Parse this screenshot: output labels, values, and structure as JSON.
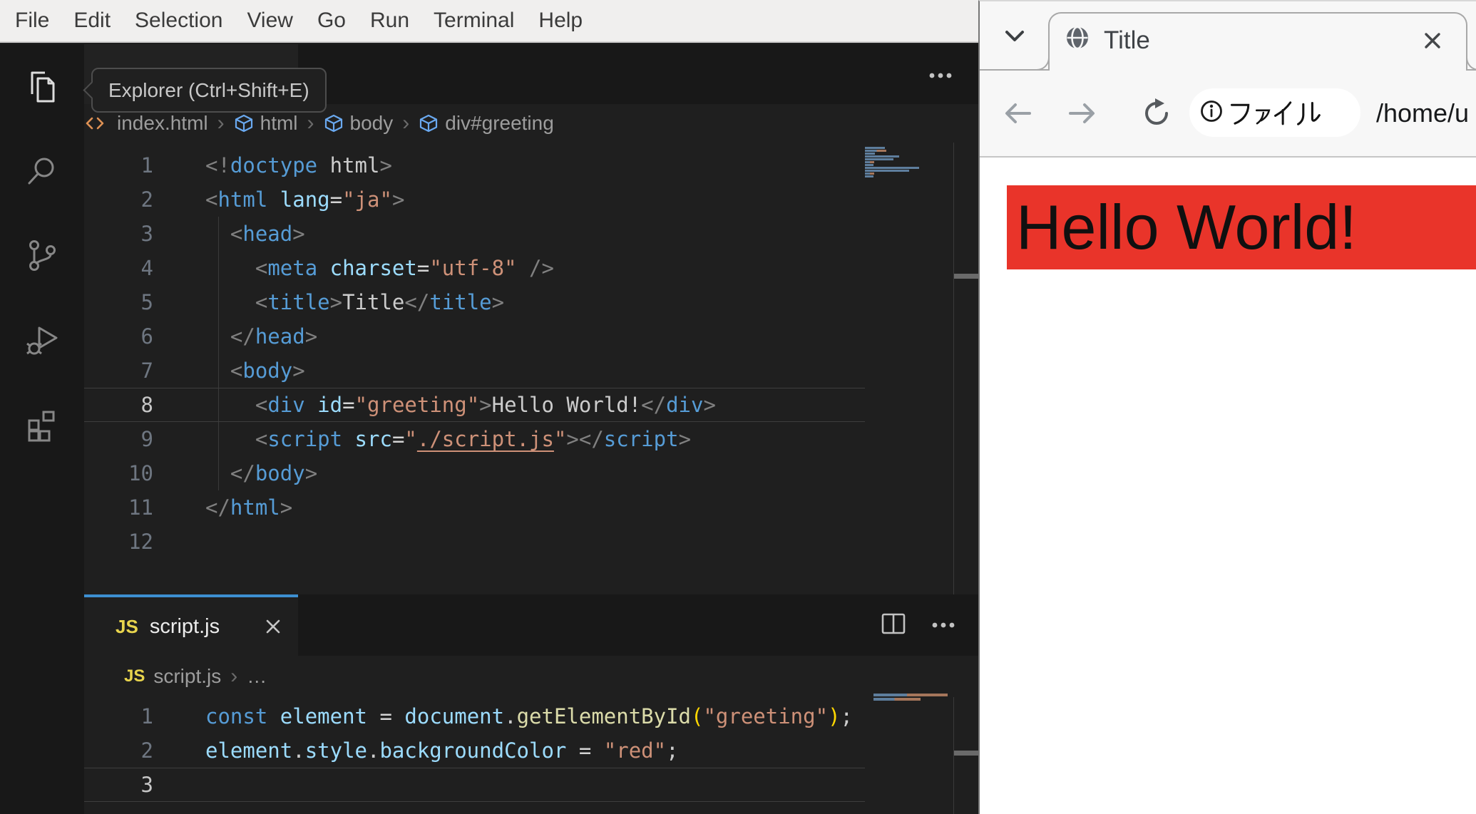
{
  "vscode": {
    "menu": {
      "items": [
        "File",
        "Edit",
        "Selection",
        "View",
        "Go",
        "Run",
        "Terminal",
        "Help"
      ]
    },
    "activity_bar": [
      "explorer",
      "search",
      "source-control",
      "run-debug",
      "extensions"
    ],
    "tooltip": "Explorer (Ctrl+Shift+E)",
    "top_editor": {
      "breadcrumbs": [
        {
          "icon": "code",
          "label": "index.html"
        },
        {
          "icon": "cube",
          "label": "html"
        },
        {
          "icon": "cube",
          "label": "body"
        },
        {
          "icon": "cube",
          "label": "div#greeting"
        }
      ],
      "active_line": 8,
      "lines": [
        {
          "n": "1",
          "t": [
            [
              "p",
              "<!"
            ],
            [
              "tag",
              "doctype"
            ],
            [
              "pl",
              " html"
            ],
            [
              "p",
              ">"
            ]
          ]
        },
        {
          "n": "2",
          "t": [
            [
              "p",
              "<"
            ],
            [
              "tag",
              "html"
            ],
            [
              "pl",
              " "
            ],
            [
              "at",
              "lang"
            ],
            [
              "op",
              "="
            ],
            [
              "st",
              "\"ja\""
            ],
            [
              "p",
              ">"
            ]
          ]
        },
        {
          "n": "3",
          "t": [
            [
              "pl",
              "  "
            ],
            [
              "p",
              "<"
            ],
            [
              "tag",
              "head"
            ],
            [
              "p",
              ">"
            ]
          ]
        },
        {
          "n": "4",
          "t": [
            [
              "pl",
              "    "
            ],
            [
              "p",
              "<"
            ],
            [
              "tag",
              "meta"
            ],
            [
              "pl",
              " "
            ],
            [
              "at",
              "charset"
            ],
            [
              "op",
              "="
            ],
            [
              "st",
              "\"utf-8\""
            ],
            [
              "pl",
              " "
            ],
            [
              "p",
              "/>"
            ]
          ]
        },
        {
          "n": "5",
          "t": [
            [
              "pl",
              "    "
            ],
            [
              "p",
              "<"
            ],
            [
              "tag",
              "title"
            ],
            [
              "p",
              ">"
            ],
            [
              "pl",
              "Title"
            ],
            [
              "p",
              "</"
            ],
            [
              "tag",
              "title"
            ],
            [
              "p",
              ">"
            ]
          ]
        },
        {
          "n": "6",
          "t": [
            [
              "pl",
              "  "
            ],
            [
              "p",
              "</"
            ],
            [
              "tag",
              "head"
            ],
            [
              "p",
              ">"
            ]
          ]
        },
        {
          "n": "7",
          "t": [
            [
              "pl",
              "  "
            ],
            [
              "p",
              "<"
            ],
            [
              "tag",
              "body"
            ],
            [
              "p",
              ">"
            ]
          ]
        },
        {
          "n": "8",
          "t": [
            [
              "pl",
              "    "
            ],
            [
              "p",
              "<"
            ],
            [
              "tag",
              "div"
            ],
            [
              "pl",
              " "
            ],
            [
              "at",
              "id"
            ],
            [
              "op",
              "="
            ],
            [
              "st",
              "\"greeting\""
            ],
            [
              "p",
              ">"
            ],
            [
              "pl",
              "Hello World!"
            ],
            [
              "p",
              "</"
            ],
            [
              "tag",
              "div"
            ],
            [
              "p",
              ">"
            ]
          ]
        },
        {
          "n": "9",
          "t": [
            [
              "pl",
              "    "
            ],
            [
              "p",
              "<"
            ],
            [
              "tag",
              "script"
            ],
            [
              "pl",
              " "
            ],
            [
              "at",
              "src"
            ],
            [
              "op",
              "="
            ],
            [
              "st",
              "\""
            ],
            [
              "lk",
              "./script.js"
            ],
            [
              "st",
              "\""
            ],
            [
              "p",
              ">"
            ],
            [
              "p",
              "</"
            ],
            [
              "tag",
              "script"
            ],
            [
              "p",
              ">"
            ]
          ]
        },
        {
          "n": "10",
          "t": [
            [
              "pl",
              "  "
            ],
            [
              "p",
              "</"
            ],
            [
              "tag",
              "body"
            ],
            [
              "p",
              ">"
            ]
          ]
        },
        {
          "n": "11",
          "t": [
            [
              "p",
              "</"
            ],
            [
              "tag",
              "html"
            ],
            [
              "p",
              ">"
            ]
          ]
        },
        {
          "n": "12",
          "t": []
        }
      ]
    },
    "panel_editor": {
      "tab": {
        "icon_text": "JS",
        "label": "script.js"
      },
      "breadcrumbs": [
        {
          "icon": "js",
          "label": "script.js"
        },
        {
          "label": "…"
        }
      ],
      "active_line": 3,
      "lines": [
        {
          "n": "1",
          "t": [
            [
              "kw",
              "const"
            ],
            [
              "pl",
              " "
            ],
            [
              "at",
              "element"
            ],
            [
              "pl",
              " "
            ],
            [
              "op",
              "="
            ],
            [
              "pl",
              " "
            ],
            [
              "at",
              "document"
            ],
            [
              "pl",
              "."
            ],
            [
              "fn",
              "getElementById"
            ],
            [
              "br",
              "("
            ],
            [
              "st",
              "\"greeting\""
            ],
            [
              "br",
              ")"
            ],
            [
              "pl",
              ";"
            ]
          ]
        },
        {
          "n": "2",
          "t": [
            [
              "at",
              "element"
            ],
            [
              "pl",
              "."
            ],
            [
              "at",
              "style"
            ],
            [
              "pl",
              "."
            ],
            [
              "at",
              "backgroundColor"
            ],
            [
              "pl",
              " "
            ],
            [
              "op",
              "="
            ],
            [
              "pl",
              " "
            ],
            [
              "st",
              "\"red\""
            ],
            [
              "pl",
              ";"
            ]
          ]
        },
        {
          "n": "3",
          "t": []
        }
      ]
    }
  },
  "browser": {
    "tab": {
      "title": "Title"
    },
    "toolbar": {
      "chip_label": "ファイル",
      "url": "/home/u"
    },
    "page": {
      "heading": "Hello World!",
      "heading_bg": "#e9342a"
    }
  },
  "colors": {
    "accent_blue": "#3d8fd1",
    "heading_red": "#e9342a",
    "js_yellow": "#e8d44d"
  }
}
